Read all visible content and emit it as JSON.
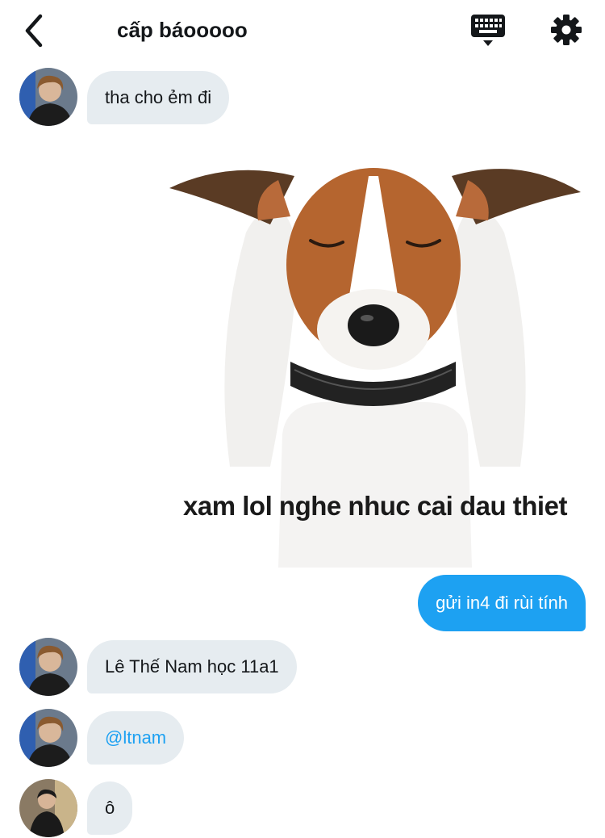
{
  "header": {
    "title": "cấp báooooo",
    "back_icon": "chevron-left-icon",
    "keyboard_icon": "keyboard-icon",
    "settings_icon": "gear-icon"
  },
  "messages": [
    {
      "direction": "incoming",
      "text": "tha cho ẻm đi"
    },
    {
      "direction": "incoming",
      "type": "image",
      "caption": "xam lol nghe nhuc cai dau thiet"
    },
    {
      "direction": "outgoing",
      "text": "gửi in4 đi rùi tính"
    },
    {
      "direction": "incoming",
      "text": "Lê Thế Nam học 11a1"
    },
    {
      "direction": "incoming",
      "text": "@ltnam"
    },
    {
      "direction": "incoming",
      "text": "ô"
    }
  ],
  "colors": {
    "accent": "#1da1f2",
    "incoming_bubble": "#e6ecf0",
    "text": "#14171a"
  }
}
